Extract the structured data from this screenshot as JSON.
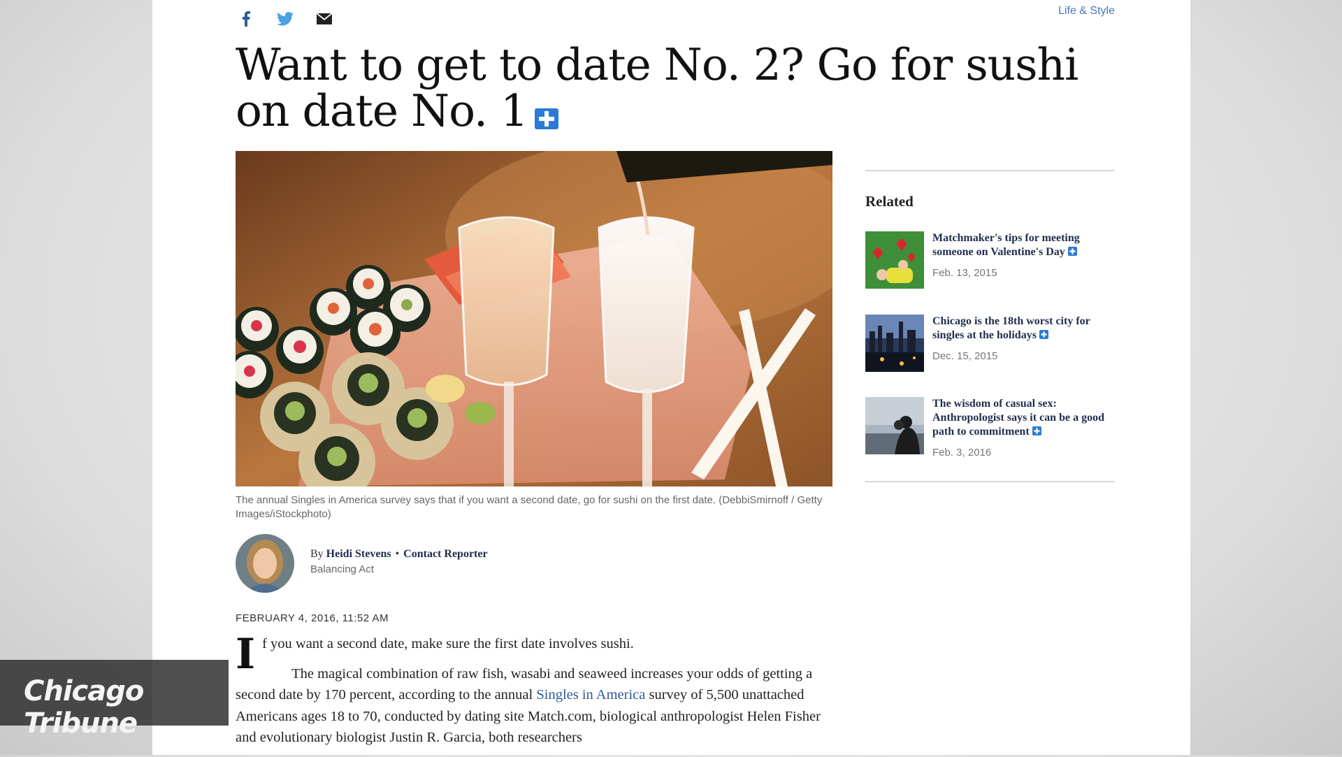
{
  "header": {
    "section": "Life & Style",
    "social_icons": [
      "facebook-icon",
      "twitter-icon",
      "email-icon"
    ]
  },
  "article": {
    "headline": "Want to get to date No. 2? Go for sushi on date No. 1",
    "photo_caption": "The annual Singles in America survey says that if you want a second date, go for sushi on the first date. (DebbiSmirnoff / Getty Images/iStockphoto)",
    "byline_prefix": "By",
    "author": "Heidi Stevens",
    "separator": "•",
    "contact": "Contact Reporter",
    "column": "Balancing Act",
    "dateline": "FEBRUARY 4, 2016, 11:52 AM",
    "dropcap": "I",
    "para1": "f you want a second date, make sure the first date involves sushi.",
    "para2_a": "The magical combination of raw fish, wasabi and seaweed increases your odds of getting a second date by 170 percent, according to the annual ",
    "para2_link": "Singles in America",
    "para2_b": " survey of 5,500 unattached Americans ages 18 to 70, conducted by dating site Match.com, biological anthropologist Helen Fisher and evolutionary biologist Justin R. Garcia, both researchers"
  },
  "related": {
    "title": "Related",
    "items": [
      {
        "headline": "Matchmaker's tips for meeting someone on Valentine's Day",
        "date": "Feb. 13, 2015"
      },
      {
        "headline": "Chicago is the 18th worst city for singles at the holidays",
        "date": "Dec. 15, 2015"
      },
      {
        "headline": "The wisdom of casual sex: Anthropologist says it can be a good path to commitment",
        "date": "Feb. 3, 2016"
      }
    ]
  },
  "overlay": {
    "logo": "Chicago Tribune"
  },
  "colors": {
    "link": "#4a78b5",
    "plus_badge": "#2b7bd6",
    "headline": "#111111"
  }
}
